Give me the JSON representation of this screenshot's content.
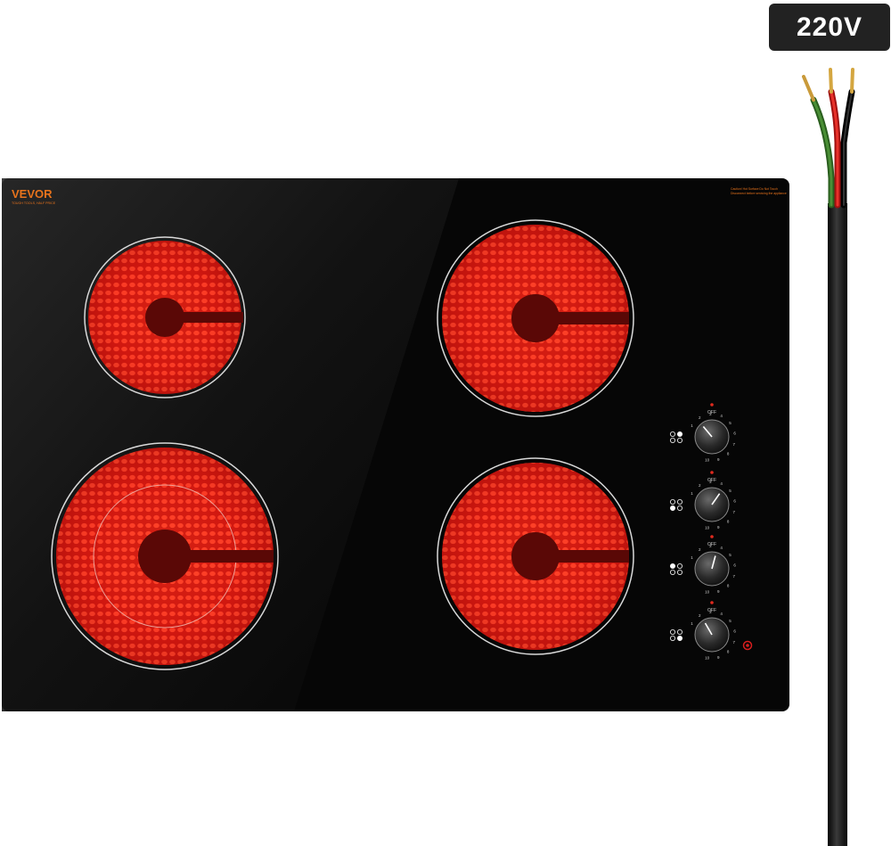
{
  "voltage_label": "220V",
  "brand": {
    "name": "VEVOR",
    "tagline": "TOUGH TOOLS, HALF PRICE"
  },
  "warning_text": [
    "Caution! Hot Surface Do Not Touch",
    "Disconnect before servicing the appliance"
  ],
  "knobs": [
    {
      "id": "knob-1",
      "off_label": "OFF",
      "ticks": [
        "1",
        "2",
        "3",
        "4",
        "5",
        "6",
        "7",
        "8",
        "9",
        "10"
      ]
    },
    {
      "id": "knob-2",
      "off_label": "OFF",
      "ticks": [
        "1",
        "2",
        "3",
        "4",
        "5",
        "6",
        "7",
        "8",
        "9",
        "10"
      ]
    },
    {
      "id": "knob-3",
      "off_label": "OFF",
      "ticks": [
        "1",
        "2",
        "3",
        "4",
        "5",
        "6",
        "7",
        "8",
        "9",
        "10"
      ]
    },
    {
      "id": "knob-4",
      "off_label": "OFF",
      "ticks": [
        "1",
        "2",
        "3",
        "4",
        "5",
        "6",
        "7",
        "8",
        "9",
        "10"
      ]
    }
  ],
  "colors": {
    "glass": "#0a0a0a",
    "burner_glow": "#ff2a1a",
    "brand_orange": "#e8731c",
    "wire_green": "#3a7a2a",
    "wire_red": "#d81e1e",
    "wire_black": "#111111",
    "copper": "#c99a3a"
  }
}
